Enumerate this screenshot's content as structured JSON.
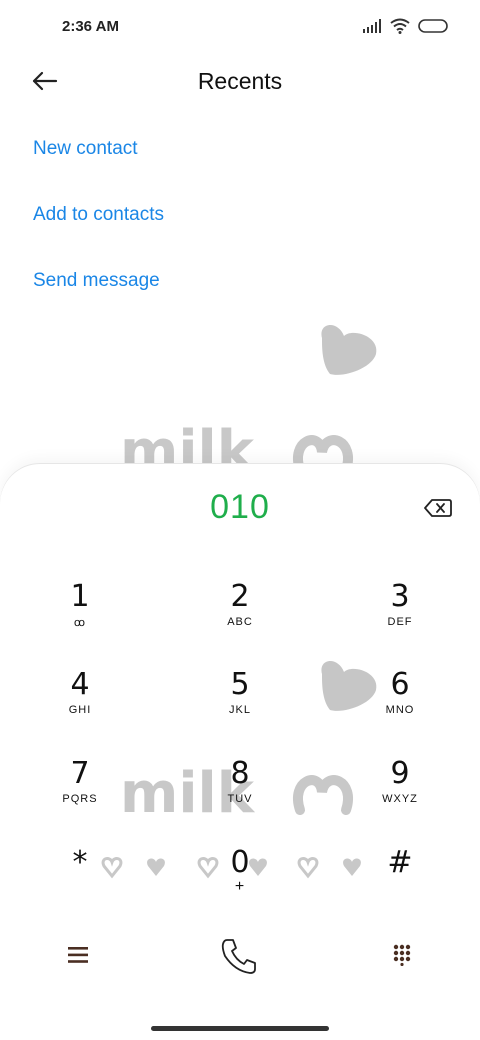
{
  "status": {
    "time": "2:36 AM",
    "icons": [
      "signal-icon",
      "wifi-icon",
      "battery-icon"
    ]
  },
  "header": {
    "title": "Recents",
    "back_icon": "arrow-left-icon"
  },
  "actions": {
    "new_contact": "New contact",
    "add_to_contacts": "Add to contacts",
    "send_message": "Send message"
  },
  "wallpaper": {
    "text": "milk"
  },
  "dialer": {
    "number": "010",
    "keys": [
      {
        "digit": "1",
        "letters": "ꝏ"
      },
      {
        "digit": "2",
        "letters": "ABC"
      },
      {
        "digit": "3",
        "letters": "DEF"
      },
      {
        "digit": "4",
        "letters": "GHI"
      },
      {
        "digit": "5",
        "letters": "JKL"
      },
      {
        "digit": "6",
        "letters": "MNO"
      },
      {
        "digit": "7",
        "letters": "PQRS"
      },
      {
        "digit": "8",
        "letters": "TUV"
      },
      {
        "digit": "9",
        "letters": "WXYZ"
      },
      {
        "digit": "*",
        "letters": ""
      },
      {
        "digit": "0",
        "letters": "+"
      },
      {
        "digit": "#",
        "letters": ""
      }
    ]
  },
  "bottom_bar": {
    "icons": [
      "menu-icon",
      "phone-icon",
      "dialpad-icon"
    ]
  },
  "colors": {
    "accent_blue": "#1a86e6",
    "number_green": "#1fae4b",
    "icon_brown": "#4a2e22"
  }
}
